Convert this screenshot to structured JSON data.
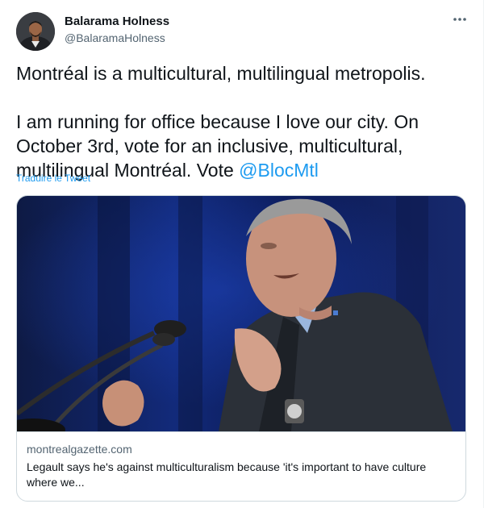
{
  "author": {
    "name": "Balarama Holness",
    "handle": "@BalaramaHolness"
  },
  "tweet": {
    "line1": "Montréal is a multicultural, multilingual metropolis.",
    "line2_before_mention": "I am running for office because I love our city. On October 3rd, vote for an inclusive, multicultural, multilingual Montréal. Vote ",
    "mention": "@BlocMtl",
    "translate_label": "Traduire le Tweet"
  },
  "more_icon": "more-horizontal-icon",
  "card": {
    "domain": "montrealgazette.com",
    "title": "Legault says he's against multiculturalism because 'it's important to have culture where we..."
  },
  "colors": {
    "accent": "#1d9bf0",
    "text": "#0f1419",
    "muted": "#536471",
    "border": "#cfd9de"
  }
}
